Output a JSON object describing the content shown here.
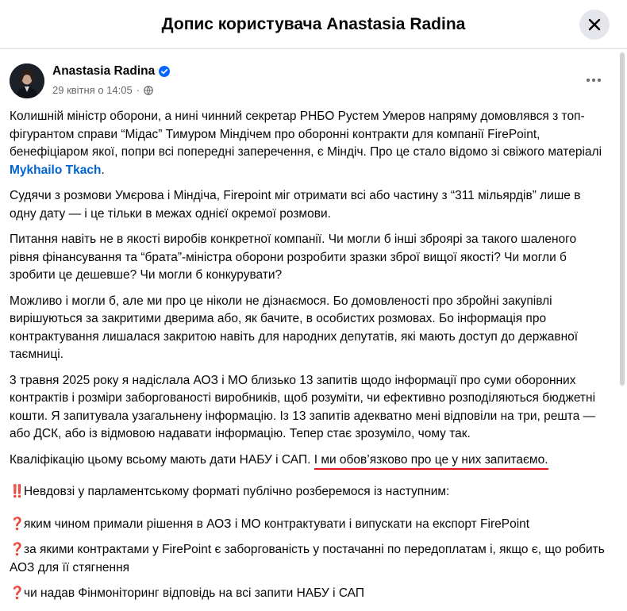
{
  "header": {
    "title": "Допис користувача Anastasia Radina"
  },
  "post": {
    "author": "Anastasia Radina",
    "date": "29 квітня о 14:05",
    "separator": "·",
    "paragraphs": {
      "p1_a": "Колишній міністр оборони, а нині чинний секретар РНБО Рустем Умеров напряму домовлявся з топ-фігурантом справи “Мідас” Тимуром Міндічем про оборонні контракти для компанії FirePoint, бенефіціаром якої, попри всі попередні заперечення, є Міндіч. Про це стало відомо зі свіжого матеріалі ",
      "p1_mention": "Mykhailo Tkach",
      "p1_end": ".",
      "p2": "Судячи з розмови Умєрова і Міндіча, Firepoint міг отримати всі або частину з “311 мільярдів” лише в одну дату — і це тільки в межах однієї окремої розмови.",
      "p3": "Питання навіть не в якості виробів конкретної компанії. Чи могли б інші зброярі за такого шаленого рівня фінансування та “брата”-міністра оборони розробити зразки зброї вищої якості? Чи могли б зробити це дешевше? Чи могли б конкурувати?",
      "p4": "Можливо і могли б, але ми про це ніколи не дізнаємося. Бо домовленості про збройні закупівлі вирішуються за закритими дверима або, як бачите, в особистих розмовах. Бо інформація про контрактування лишалася закритою навіть для народних депутатів, які мають доступ до державної таємниці.",
      "p5": "3 травня 2025 року я надіслала АОЗ і МО близько 13 запитів щодо інформації про суми оборонних контрактів і розміри заборгованості виробників, щоб розуміти, чи ефективно розподіляються бюджетні кошти. Я запитувала узагальнену інформацію. Із 13 запитів адекватно мені відповіли на три, решта — або ДСК, або із відмовою надавати інформацію. Тепер стає зрозуміло, чому так.",
      "p6_a": "Кваліфікацію цьому всьому мають дати НАБУ і САП. ",
      "p6_underlined": "І ми обов’язково про це у них запитаємо.",
      "intro_mark": "‼️",
      "intro": "Невдовзі у парламентському форматі публічно розберемося із наступним:",
      "q_mark": "❓",
      "q1": "яким чином примали рішення в АОЗ і МО контрактувати і випускати на експорт FirePoint",
      "q2": "за якими контрактами у FirePoint є заборгованість у постачанні по передоплатам і, якщо є, що робить АОЗ для її стягнення",
      "q3": "чи надав Фінмоніторинг відповідь на всі запити НАБУ і САП"
    }
  },
  "icons": {
    "close": "close-icon",
    "verified": "verified-badge-icon",
    "globe": "globe-icon",
    "more": "more-options-icon"
  },
  "colors": {
    "mention": "#0064d1",
    "underline": "#e0161b",
    "verified": "#0866ff"
  }
}
